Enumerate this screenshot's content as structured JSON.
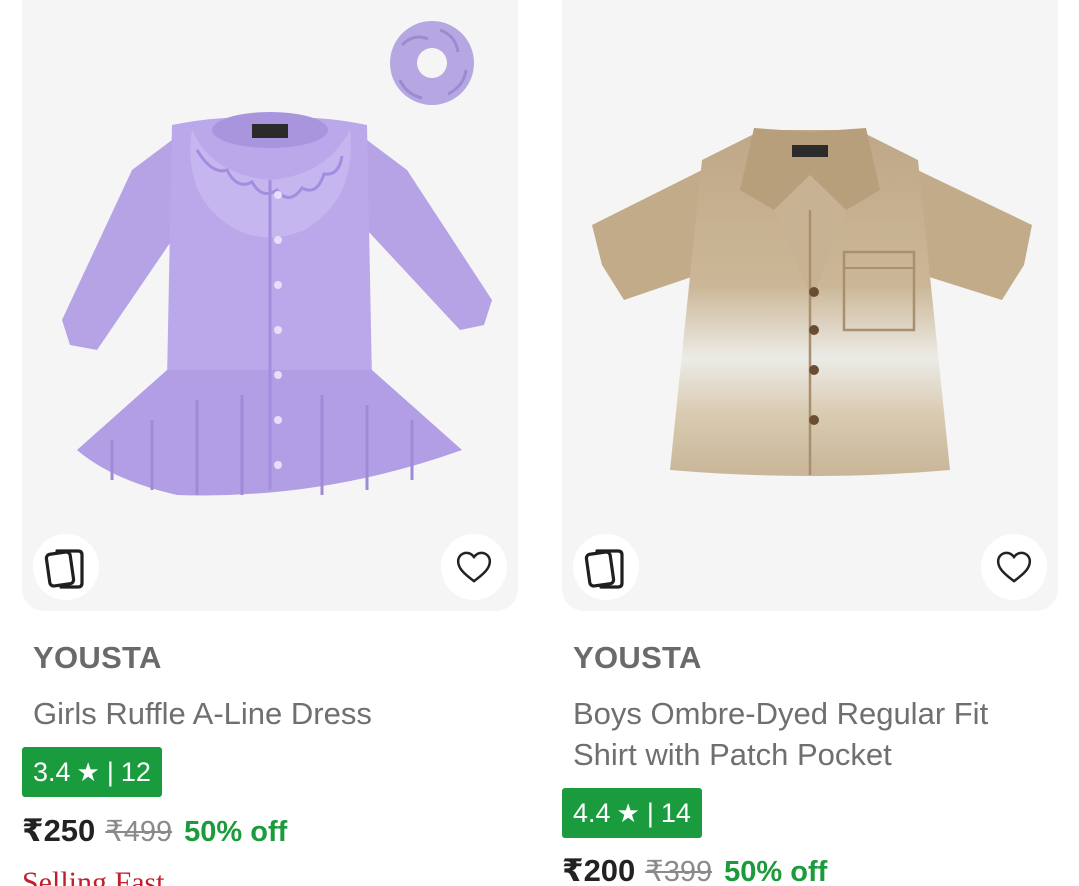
{
  "products": [
    {
      "brand": "YOUSTA",
      "name": "Girls Ruffle A-Line Dress",
      "rating": "3.4",
      "rating_star": "★",
      "rating_separator": "|",
      "rating_count": "12",
      "price": "₹250",
      "mrp": "₹499",
      "discount": "50% off",
      "tag": "Selling Fast",
      "image_icon": "lilac-ruffle-dress-with-scrunchie",
      "similar_icon": "similar-products-icon",
      "wishlist_icon": "heart-icon"
    },
    {
      "brand": "YOUSTA",
      "name": "Boys Ombre-Dyed Regular Fit Shirt with Patch Pocket",
      "rating": "4.4",
      "rating_star": "★",
      "rating_separator": "|",
      "rating_count": "14",
      "price": "₹200",
      "mrp": "₹399",
      "discount": "50% off",
      "image_icon": "beige-ombre-shirt",
      "similar_icon": "similar-products-icon",
      "wishlist_icon": "heart-icon"
    }
  ],
  "colors": {
    "rating_badge": "#1a9c3e",
    "discount_text": "#1b9b3b",
    "selling_fast_text": "#c0202b",
    "image_background": "#f5f5f6"
  }
}
